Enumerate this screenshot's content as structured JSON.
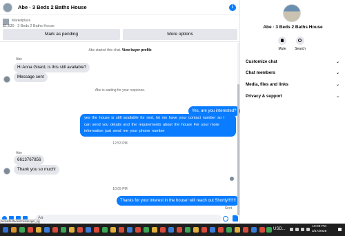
{
  "chat": {
    "title": "Abe · 3 Beds 2 Baths House",
    "info_glyph": "i",
    "listing": {
      "source": "Marketplace",
      "price_title": "$1,630 · 3 Beds 2 Baths House",
      "mark_pending": "Mark as pending",
      "more_options": "More options"
    },
    "started_prefix": "Abe started this chat.",
    "view_profile": "View buyer profile",
    "sender_name_1": "Abe",
    "msg_in_1": "Hi Anna Girard, is this still available?",
    "msg_in_2": "Message sent",
    "waiting": "Abe is waiting for your response.",
    "msg_out_1": "Yes, are you interested?",
    "msg_out_2": "yes the house is still available for rent, let me have your contact number so I can send you details and the requirements about the house For  your  more  information  just  send  me   your   phone  number",
    "time_1": "12:53 PM",
    "sender_name_2": "Abe",
    "msg_in_3": "6613767856",
    "msg_in_4": "Thank you so much!",
    "time_2": "10:09 PM",
    "msg_out_3": "Thanks for your interest in the house! will reach out Shortly!!!!!!!",
    "sent_label": "Sent",
    "composer_placeholder": "Aa",
    "status_url": "ternalSurfaces/messenger_lightsp..."
  },
  "panel": {
    "title": "Abe · 3 Beds 2 Baths House",
    "mute": "Mute",
    "search": "Search",
    "sections": [
      "Customize chat",
      "Chat members",
      "Media, files and links",
      "Privacy & support"
    ]
  },
  "taskbar": {
    "currency": "USD...",
    "time": "10:09 PM",
    "date": "3/17/2025"
  },
  "colors": {
    "accent": "#0a7cff",
    "bubble_in": "#e4e6eb",
    "taskbar": "#1f1f1f"
  }
}
